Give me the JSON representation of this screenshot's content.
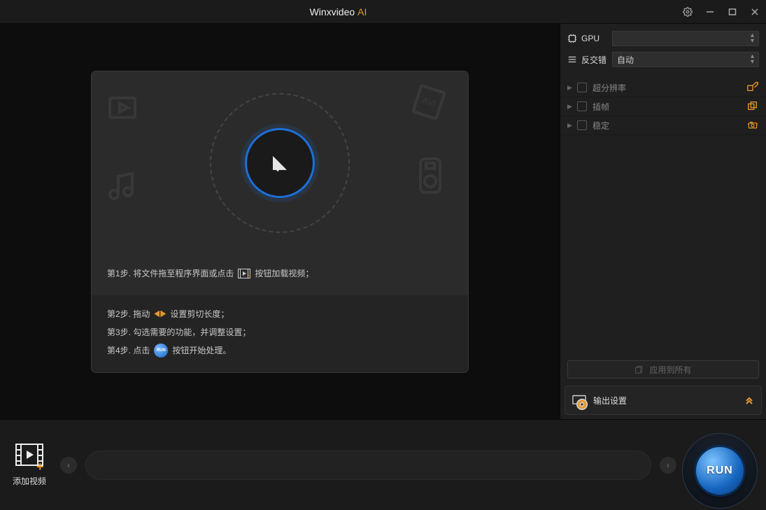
{
  "title": {
    "name": "Winxvideo",
    "suffix": "AI"
  },
  "side": {
    "gpu": {
      "label": "GPU",
      "value": ""
    },
    "deinterlace": {
      "label": "反交错",
      "value": "自动"
    },
    "toggles": [
      {
        "label": "超分辨率",
        "icon": "upscale"
      },
      {
        "label": "插帧",
        "icon": "frame-interpolation"
      },
      {
        "label": "稳定",
        "icon": "stabilize"
      }
    ],
    "apply_all": "应用到所有",
    "output": "输出设置"
  },
  "steps": {
    "s1a": "第1步. 将文件拖至程序界面或点击",
    "s1b": "按钮加载视频；",
    "s2a": "第2步. 拖动",
    "s2b": "设置剪切长度；",
    "s3": "第3步. 勾选需要的功能，并调整设置；",
    "s4a": "第4步. 点击",
    "s4b": "按钮开始处理。",
    "run_chip": "RUN"
  },
  "bottom": {
    "add_video": "添加视频",
    "run": "RUN"
  }
}
